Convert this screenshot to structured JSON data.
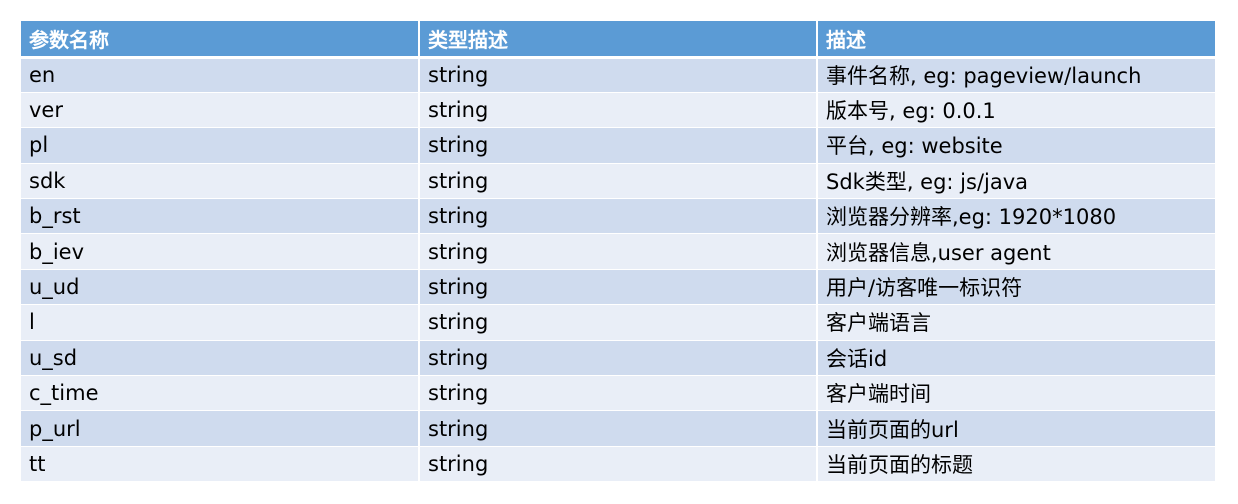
{
  "table": {
    "headers": [
      "参数名称",
      "类型描述",
      "描述"
    ],
    "rows": [
      [
        "en",
        "string",
        "事件名称, eg: pageview/launch"
      ],
      [
        "ver",
        "string",
        "版本号, eg: 0.0.1"
      ],
      [
        "pl",
        "string",
        "平台, eg: website"
      ],
      [
        "sdk",
        "string",
        "Sdk类型, eg: js/java"
      ],
      [
        "b_rst",
        "string",
        "浏览器分辨率,eg: 1920*1080"
      ],
      [
        "b_iev",
        "string",
        "浏览器信息,user agent"
      ],
      [
        "u_ud",
        "string",
        "用户/访客唯一标识符"
      ],
      [
        "l",
        "string",
        "客户端语言"
      ],
      [
        "u_sd",
        "string",
        "会话id"
      ],
      [
        "c_time",
        "string",
        "客户端时间"
      ],
      [
        "p_url",
        "string",
        "当前页面的url"
      ],
      [
        "tt",
        "string",
        "当前页面的标题"
      ]
    ]
  },
  "colors": {
    "header_bg": "#5b9bd5",
    "row_dark": "#cfdbee",
    "row_light": "#e9eef7"
  }
}
